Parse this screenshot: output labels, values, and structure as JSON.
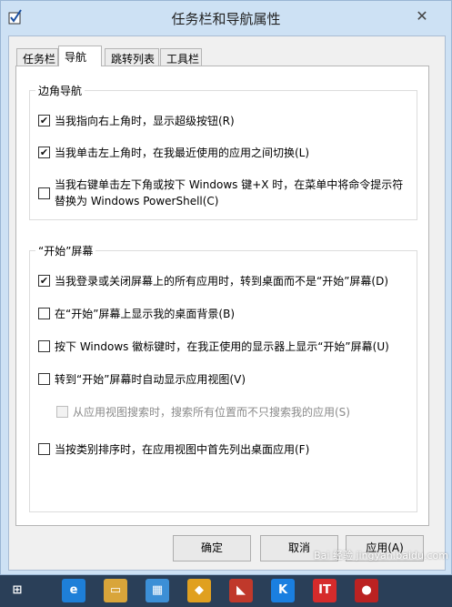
{
  "window": {
    "title": "任务栏和导航属性",
    "close_symbol": "✕"
  },
  "tabs": [
    {
      "label": "任务栏"
    },
    {
      "label": "导航"
    },
    {
      "label": "跳转列表"
    },
    {
      "label": "工具栏"
    }
  ],
  "corner_nav": {
    "title": "边角导航",
    "options": [
      {
        "label": "当我指向右上角时，显示超级按钮(R)",
        "checked": true
      },
      {
        "label": "当我单击左上角时，在我最近使用的应用之间切换(L)",
        "checked": true
      },
      {
        "label": "当我右键单击左下角或按下 Windows 键+X 时，在菜单中将命令提示符替换为 Windows PowerShell(C)",
        "checked": false
      }
    ]
  },
  "start_screen": {
    "title": "“开始”屏幕",
    "options": [
      {
        "label": "当我登录或关闭屏幕上的所有应用时，转到桌面而不是“开始”屏幕(D)",
        "checked": true
      },
      {
        "label": "在“开始”屏幕上显示我的桌面背景(B)",
        "checked": false
      },
      {
        "label": "按下 Windows 徽标键时，在我正使用的显示器上显示“开始”屏幕(U)",
        "checked": false
      },
      {
        "label": "转到“开始”屏幕时自动显示应用视图(V)",
        "checked": false
      },
      {
        "label": "从应用视图搜索时，搜索所有位置而不只搜索我的应用(S)",
        "checked": false,
        "disabled": true
      },
      {
        "label": "当按类别排序时，在应用视图中首先列出桌面应用(F)",
        "checked": false
      }
    ]
  },
  "buttons": {
    "ok": "确定",
    "cancel": "取消",
    "apply": "应用(A)"
  },
  "taskbar": {
    "items": [
      {
        "icon": "windows-start-icon",
        "glyph": "⊞",
        "color": "#2a3f58"
      },
      {
        "icon": "internet-explorer-icon",
        "glyph": "e",
        "color": "#1e7fd8"
      },
      {
        "icon": "file-explorer-icon",
        "glyph": "▭",
        "color": "#d9a53a"
      },
      {
        "icon": "tiles-app-icon",
        "glyph": "▦",
        "color": "#3c8fd6"
      },
      {
        "icon": "security-shield-icon",
        "glyph": "◆",
        "color": "#e0a020"
      },
      {
        "icon": "red-app-icon",
        "glyph": "◣",
        "color": "#c0392b"
      },
      {
        "icon": "kugou-music-icon",
        "glyph": "K",
        "color": "#1a7fe0"
      },
      {
        "icon": "ithome-icon",
        "glyph": "IT",
        "color": "#d62b2b"
      },
      {
        "icon": "record-app-icon",
        "glyph": "●",
        "color": "#bb2222"
      }
    ]
  },
  "watermark": {
    "text": "Bai 经验  jingyan.baidu.com"
  }
}
